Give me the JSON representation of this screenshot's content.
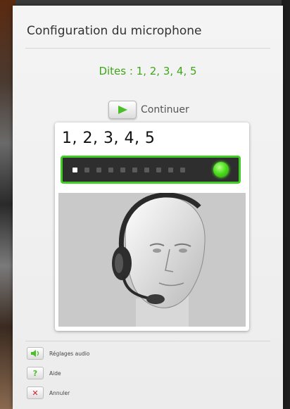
{
  "dialog": {
    "title": "Configuration du microphone",
    "prompt": "Dites : 1, 2, 3, 4, 5",
    "continue_label": "Continuer",
    "card_text": "1, 2, 3, 4, 5",
    "meter": {
      "level_fraction": 0.1,
      "segments": 10,
      "active_segments": 1,
      "led_state": "ok"
    }
  },
  "footer": {
    "items": [
      {
        "label": "Réglages audio",
        "icon": "speaker-icon"
      },
      {
        "label": "Aide",
        "icon": "question-icon"
      },
      {
        "label": "Annuler",
        "icon": "close-icon"
      }
    ]
  },
  "colors": {
    "accent_green": "#3fa51a",
    "meter_border": "#3fcf22",
    "meter_bg": "#2e2e2e"
  }
}
